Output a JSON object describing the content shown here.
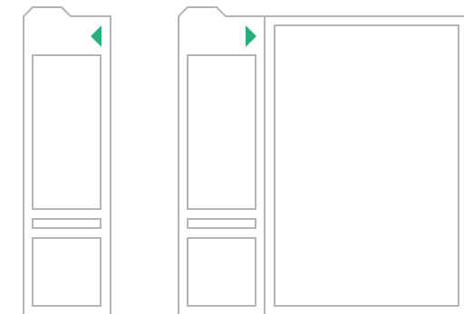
{
  "colors": {
    "outline": "#b3b3b3",
    "accent": "#22b07d",
    "background": "#ffffff"
  },
  "diagram": {
    "left_state": {
      "panel": "collapsed",
      "toggle_icon": "triangle-left-icon"
    },
    "right_state": {
      "panel": "expanded",
      "toggle_icon": "triangle-right-icon",
      "has_content_area": true
    }
  }
}
